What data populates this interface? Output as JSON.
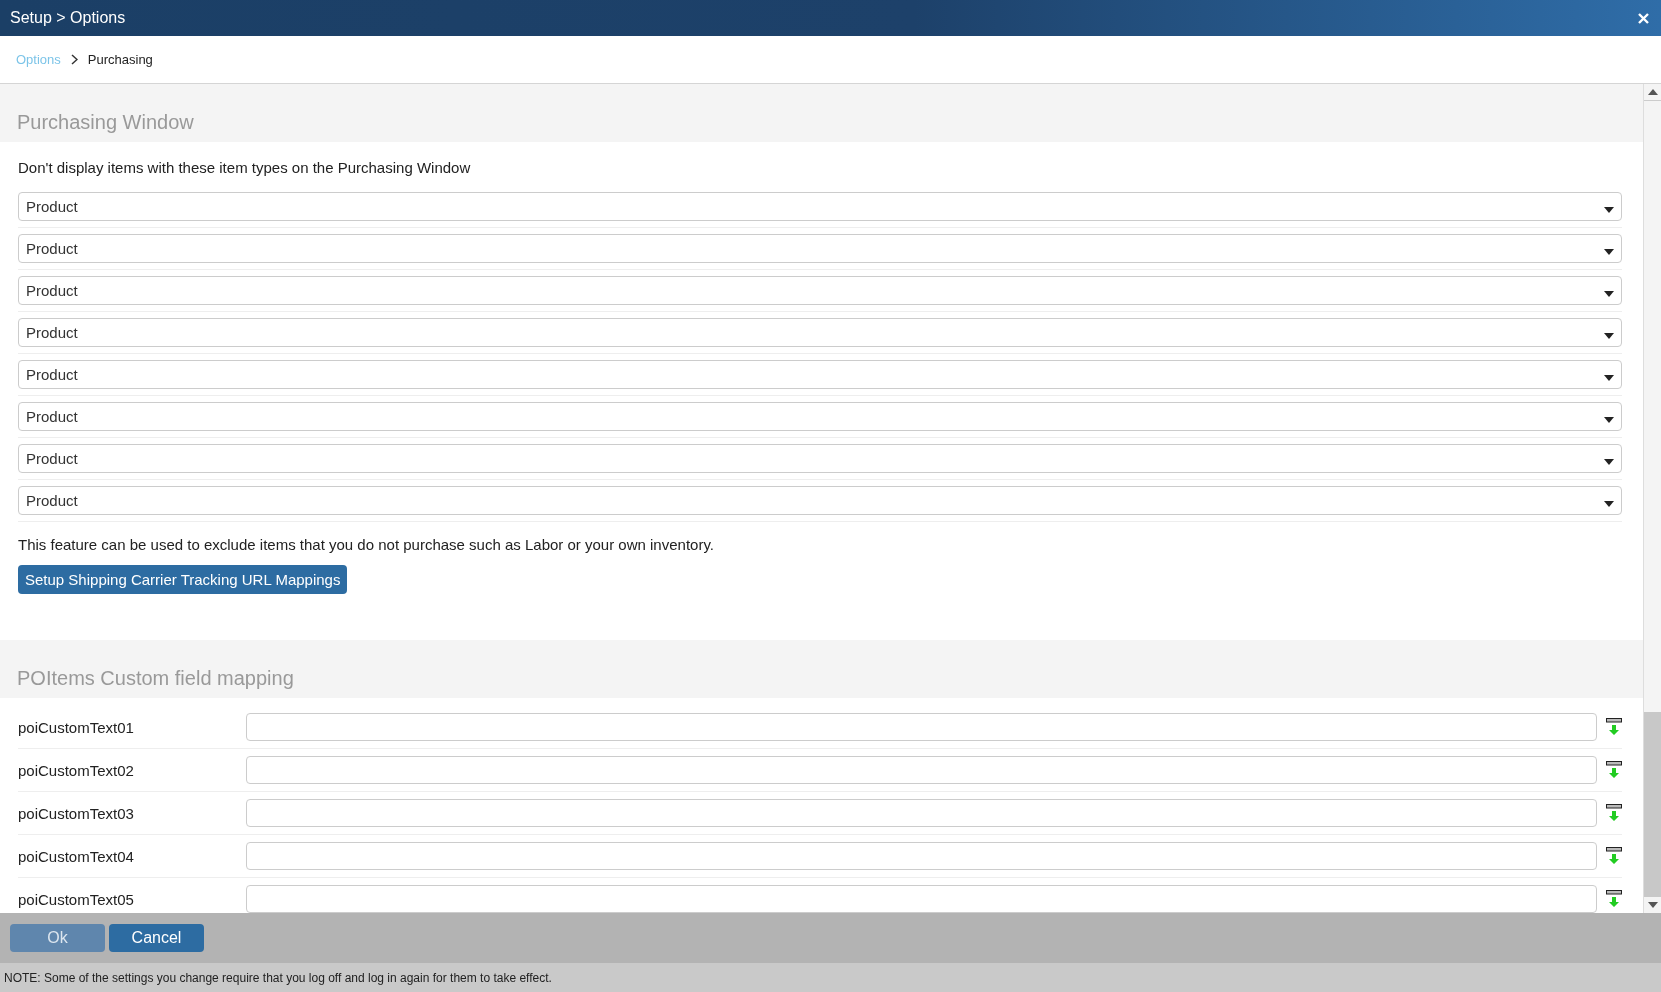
{
  "window": {
    "title": "Setup > Options"
  },
  "breadcrumb": [
    {
      "label": "Options",
      "kind": "link"
    },
    {
      "label": "Purchasing",
      "kind": "current"
    }
  ],
  "purchasing": {
    "heading": "Purchasing Window",
    "description": "Don't display items with these item types on the Purchasing Window",
    "item_types": [
      "Product",
      "Product",
      "Product",
      "Product",
      "Product",
      "Product",
      "Product",
      "Product"
    ],
    "note": "This feature can be used to exclude items that you do not purchase such as Labor or your own inventory.",
    "button": "Setup Shipping Carrier Tracking URL Mappings"
  },
  "custom_fields": {
    "heading": "POItems Custom field mapping",
    "rows": [
      {
        "label": "poiCustomText01"
      },
      {
        "label": "poiCustomText02"
      },
      {
        "label": "poiCustomText03"
      },
      {
        "label": "poiCustomText04"
      },
      {
        "label": "poiCustomText05"
      }
    ]
  },
  "buttons": [
    {
      "label": "Ok",
      "disabled": true
    },
    {
      "label": "Cancel",
      "disabled": false
    }
  ],
  "status_bar": "NOTE: Some of the settings you change require that you log off and log in again for them to take effect."
}
